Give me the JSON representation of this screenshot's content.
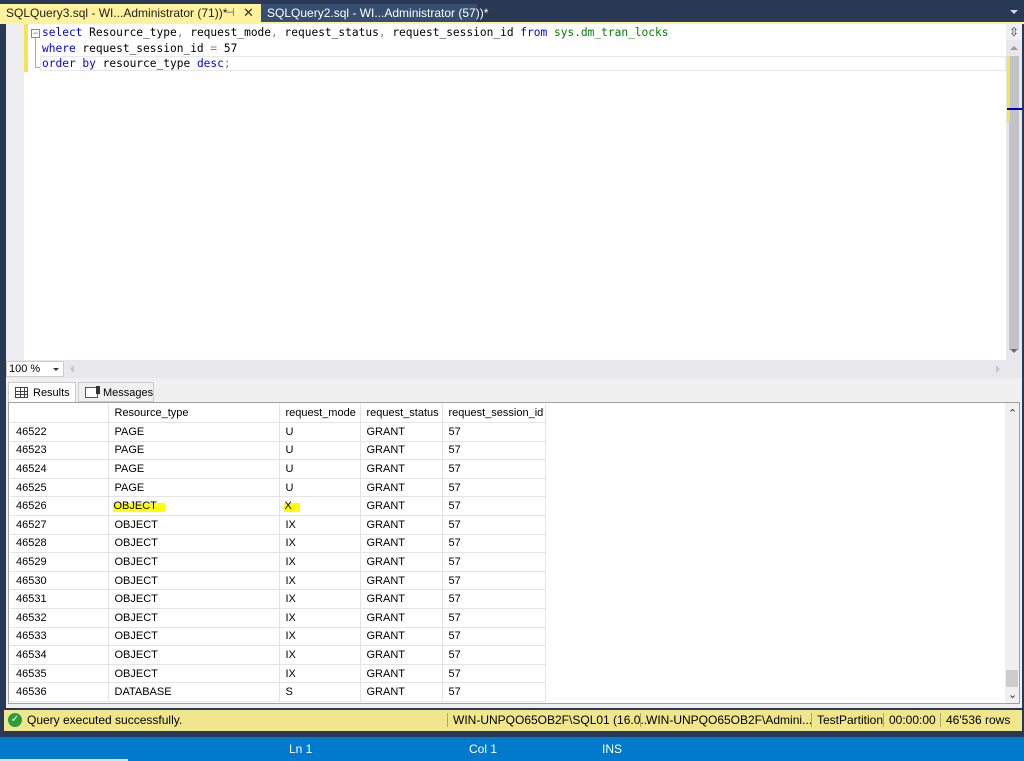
{
  "tabs": [
    {
      "label": "SQLQuery3.sql - WI...Administrator (71))*",
      "active": true,
      "pin_icon": "pin-icon",
      "close_icon": "close-icon"
    },
    {
      "label": "SQLQuery2.sql - WI...Administrator (57))*",
      "active": false
    }
  ],
  "editor": {
    "fold_glyph": "−",
    "lines": [
      {
        "tokens": [
          {
            "t": "select",
            "c": "kw"
          },
          {
            "t": " Resource_type",
            "c": ""
          },
          {
            "t": ",",
            "c": "op"
          },
          {
            "t": " request_mode",
            "c": ""
          },
          {
            "t": ",",
            "c": "op"
          },
          {
            "t": " request_status",
            "c": ""
          },
          {
            "t": ",",
            "c": "op"
          },
          {
            "t": " request_session_id ",
            "c": ""
          },
          {
            "t": "from",
            "c": "kw"
          },
          {
            "t": " sys.dm_tran_locks",
            "c": "sys"
          }
        ]
      },
      {
        "tokens": [
          {
            "t": "where",
            "c": "kw"
          },
          {
            "t": " request_session_id ",
            "c": ""
          },
          {
            "t": "=",
            "c": "op"
          },
          {
            "t": " 57",
            "c": ""
          }
        ]
      },
      {
        "tokens": [
          {
            "t": "order by",
            "c": "kw"
          },
          {
            "t": " resource_type ",
            "c": ""
          },
          {
            "t": "desc",
            "c": "kw"
          },
          {
            "t": ";",
            "c": "op"
          }
        ]
      }
    ],
    "split_glyph": "⇳"
  },
  "zoom": {
    "value": "100 %"
  },
  "results_tabs": {
    "results": "Results",
    "messages": "Messages"
  },
  "grid": {
    "columns": [
      "",
      "Resource_type",
      "request_mode",
      "request_status",
      "request_session_id"
    ],
    "rows": [
      {
        "n": "46522",
        "type": "PAGE",
        "mode": "U",
        "status": "GRANT",
        "sid": "57"
      },
      {
        "n": "46523",
        "type": "PAGE",
        "mode": "U",
        "status": "GRANT",
        "sid": "57"
      },
      {
        "n": "46524",
        "type": "PAGE",
        "mode": "U",
        "status": "GRANT",
        "sid": "57"
      },
      {
        "n": "46525",
        "type": "PAGE",
        "mode": "U",
        "status": "GRANT",
        "sid": "57"
      },
      {
        "n": "46526",
        "type": "OBJECT",
        "mode": "X",
        "status": "GRANT",
        "sid": "57",
        "highlight": true
      },
      {
        "n": "46527",
        "type": "OBJECT",
        "mode": "IX",
        "status": "GRANT",
        "sid": "57"
      },
      {
        "n": "46528",
        "type": "OBJECT",
        "mode": "IX",
        "status": "GRANT",
        "sid": "57"
      },
      {
        "n": "46529",
        "type": "OBJECT",
        "mode": "IX",
        "status": "GRANT",
        "sid": "57"
      },
      {
        "n": "46530",
        "type": "OBJECT",
        "mode": "IX",
        "status": "GRANT",
        "sid": "57"
      },
      {
        "n": "46531",
        "type": "OBJECT",
        "mode": "IX",
        "status": "GRANT",
        "sid": "57"
      },
      {
        "n": "46532",
        "type": "OBJECT",
        "mode": "IX",
        "status": "GRANT",
        "sid": "57"
      },
      {
        "n": "46533",
        "type": "OBJECT",
        "mode": "IX",
        "status": "GRANT",
        "sid": "57"
      },
      {
        "n": "46534",
        "type": "OBJECT",
        "mode": "IX",
        "status": "GRANT",
        "sid": "57"
      },
      {
        "n": "46535",
        "type": "OBJECT",
        "mode": "IX",
        "status": "GRANT",
        "sid": "57"
      },
      {
        "n": "46536",
        "type": "DATABASE",
        "mode": "S",
        "status": "GRANT",
        "sid": "57"
      }
    ],
    "highlight_color": "#ffff00"
  },
  "query_status": {
    "icon": "check-circle-icon",
    "message": "Query executed successfully.",
    "server": "WIN-UNPQO65OB2F\\SQL01 (16.0...",
    "user": "WIN-UNPQO65OB2F\\Admini...",
    "database": "TestPartition",
    "elapsed": "00:00:00",
    "rows": "46'536 rows",
    "color": "#f0e68c"
  },
  "statusbar": {
    "ln": "Ln 1",
    "col": "Col 1",
    "mode": "INS",
    "color": "#007acc"
  }
}
